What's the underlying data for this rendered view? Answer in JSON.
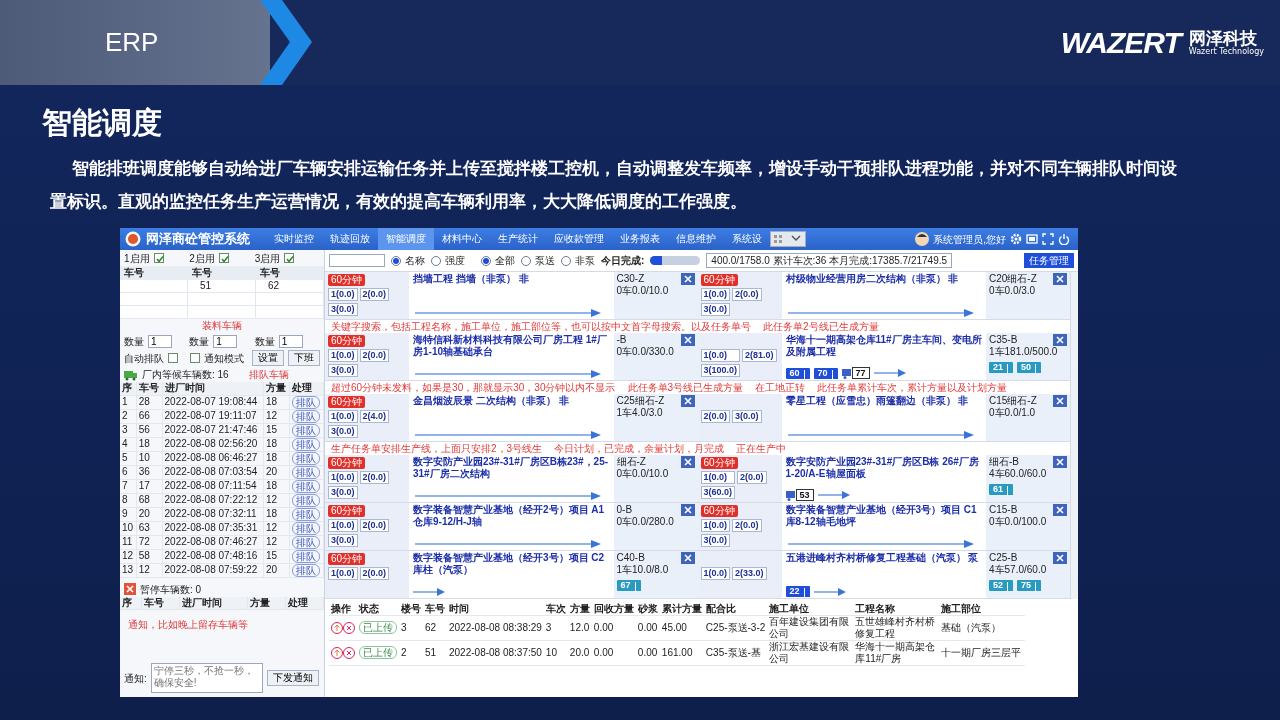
{
  "header": {
    "title": "ERP",
    "logo": "WAZERT",
    "logo_cn": "网泽科技",
    "logo_en": "Wazert Technology"
  },
  "slide_title": "智能调度",
  "intro": "智能排班调度能够自动给进厂车辆安排运输任务并上传至搅拌楼工控机，自动调整发车频率，增设手动干预排队进程功能，并对不同车辆排队时间设置标识。直观的监控任务生产运营情况，有效的提高车辆利用率，大大降低调度的工作强度。",
  "app": {
    "title": "网泽商砼管控系统",
    "nav": [
      {
        "label": "实时监控",
        "selected": false
      },
      {
        "label": "轨迹回放",
        "selected": false
      },
      {
        "label": "智能调度",
        "selected": true
      },
      {
        "label": "材料中心",
        "selected": false
      },
      {
        "label": "生产统计",
        "selected": false
      },
      {
        "label": "应收款管理",
        "selected": false
      },
      {
        "label": "业务报表",
        "selected": false
      },
      {
        "label": "信息维护",
        "selected": false
      },
      {
        "label": "系统设",
        "selected": false
      }
    ],
    "user": "系统管理员,您好",
    "lines": [
      {
        "label": "1启用",
        "checked": true
      },
      {
        "label": "2启用",
        "checked": true
      },
      {
        "label": "3启用",
        "checked": true
      }
    ],
    "loading": [
      {
        "header": "车号",
        "qty_label": "数量",
        "qty": "1"
      },
      {
        "header": "车号",
        "vehicles": [
          "51"
        ],
        "qty_label": "数量",
        "qty": "1"
      },
      {
        "header": "车号",
        "vehicles": [
          "62"
        ],
        "qty_label": "数量",
        "qty": "1"
      }
    ],
    "auto_queue": {
      "label": "自动排队",
      "checked": false
    },
    "notify_mode": {
      "label": "通知模式",
      "checked": false
    },
    "buttons": [
      "设置",
      "下班"
    ],
    "queue": {
      "title": "厂内等候车辆数: 16",
      "columns": [
        "序",
        "车号",
        "进厂时间",
        "方量",
        "处理"
      ],
      "rows": [
        [
          "1",
          "28",
          "2022-08-07 19:08:44",
          "18",
          "排队"
        ],
        [
          "2",
          "66",
          "2022-08-07 19:11:07",
          "12",
          "排队"
        ],
        [
          "3",
          "56",
          "2022-08-07 21:47:46",
          "15",
          "排队"
        ],
        [
          "4",
          "18",
          "2022-08-08 02:56:20",
          "18",
          "排队"
        ],
        [
          "5",
          "10",
          "2022-08-08 06:46:27",
          "18",
          "排队"
        ],
        [
          "6",
          "36",
          "2022-08-08 07:03:54",
          "20",
          "排队"
        ],
        [
          "7",
          "17",
          "2022-08-08 07:11:54",
          "18",
          "排队"
        ],
        [
          "8",
          "68",
          "2022-08-08 07:22:12",
          "12",
          "排队"
        ],
        [
          "9",
          "20",
          "2022-08-08 07:32:11",
          "18",
          "排队"
        ],
        [
          "10",
          "63",
          "2022-08-08 07:35:31",
          "12",
          "排队"
        ],
        [
          "11",
          "72",
          "2022-08-08 07:46:27",
          "12",
          "排队"
        ],
        [
          "12",
          "58",
          "2022-08-08 07:48:16",
          "15",
          "排队"
        ],
        [
          "13",
          "12",
          "2022-08-08 07:59:22",
          "20",
          "排队"
        ]
      ]
    },
    "paused": {
      "title": "暂停车辆数: 0",
      "columns": [
        "序",
        "车号",
        "进厂时间",
        "方量",
        "处理"
      ]
    },
    "notice": {
      "label": "通知:",
      "placeholder": "宁停三秒，不抢一秒，确保安全!",
      "button": "下发通知"
    },
    "toolbar": {
      "filter_a": [
        {
          "label": "名称",
          "selected": true
        },
        {
          "label": "强度",
          "selected": false
        }
      ],
      "filter_b": [
        {
          "label": "全部",
          "selected": true
        },
        {
          "label": "泵送",
          "selected": false
        },
        {
          "label": "非泵",
          "selected": false
        }
      ],
      "today_label": "今日完成:",
      "level": 0.23,
      "stats": "400.0/1758.0 累计车次:36 本月完成:17385.7/21749.5",
      "task_button": "任务管理"
    },
    "tasks": [
      {
        "badge": "60分钟",
        "lines": [
          "1(0.0)",
          "2(0.0)",
          "3(0.0)"
        ],
        "title": "挡墙工程 挡墙（非泵） 非",
        "spec": "C30-Z",
        "progress": "0车0.0/10.0"
      },
      {
        "badge": "60分钟",
        "lines": [
          "1(0.0)",
          "2(0.0)",
          "3(0.0)"
        ],
        "title": "村级物业经营用房二次结构（非泵） 非",
        "spec": "C20细石-Z",
        "progress": "0车0.0/3.0"
      },
      {
        "badge": "60分钟",
        "lines": [
          "1(0.0)",
          "2(0.0)",
          "3(0.0)"
        ],
        "title": "海特信科新材料科技有限公司厂房工程 1#厂房1-10轴基础承台",
        "spec": "-B",
        "progress": "0车0.0/330.0"
      },
      {
        "lines": [
          "1(0.0)",
          "2(81.0)",
          "3(100.0)"
        ],
        "title": "华海十一期高架仓库11#厂房主车间、变电所及附属工程",
        "spec": "C35-B",
        "progress": "1车181.0/500.0",
        "trucks": [
          {
            "number": "60",
            "kind": "road",
            "color": "#1f4fd8"
          },
          {
            "number": "70",
            "kind": "road",
            "color": "#1f4fd8"
          },
          {
            "number": "77",
            "kind": "tag",
            "color": "#3a5fc8"
          },
          {
            "number": "21",
            "kind": "site",
            "color": "#2a9bc0"
          },
          {
            "number": "50",
            "kind": "site",
            "color": "#2a9bc0"
          }
        ]
      },
      {
        "badge": "60分钟",
        "lines": [
          "1(0.0)",
          "2(4.0)",
          "3(0.0)"
        ],
        "title": "金昌烟波辰景 二次结构（非泵） 非",
        "spec": "C25细石-Z",
        "progress": "1车4.0/3.0"
      },
      {
        "lines": [
          "2(0.0)",
          "3(0.0)"
        ],
        "title": "零星工程（应雪忠）雨篷翻边（非泵） 非",
        "spec": "C15细石-Z",
        "progress": "0车0.0/1.0"
      },
      {
        "badge": "60分钟",
        "lines": [
          "1(0.0)",
          "2(0.0)",
          "3(0.0)"
        ],
        "title": "数字安防产业园23#-31#厂房区B栋23#，25-31#厂房二次结构",
        "spec": "细石-Z",
        "progress": "0车0.0/10.0"
      },
      {
        "badge": "60分钟",
        "lines": [
          "1(0.0)",
          "2(0.0)",
          "3(60.0)"
        ],
        "title": "数字安防产业园23#-31#厂房区B栋 26#厂房1-20/A-E轴屋面板",
        "spec": "细石-B",
        "progress": "4车60.0/60.0",
        "trucks": [
          {
            "number": "53",
            "kind": "tag",
            "color": "#3a5fc8"
          },
          {
            "number": "61",
            "kind": "site",
            "color": "#2a9bc0"
          }
        ]
      },
      {
        "badge": "60分钟",
        "lines": [
          "1(0.0)",
          "2(0.0)",
          "3(0.0)"
        ],
        "title": "数字装备智慧产业基地（经开2号）项目 A1仓库9-12/H-J轴",
        "spec": "0-B",
        "progress": "0车0.0/280.0"
      },
      {
        "badge": "60分钟",
        "lines": [
          "1(0.0)",
          "2(0.0)",
          "3(0.0)"
        ],
        "title": "数字装备智慧产业基地（经开3号）项目 C1库8-12轴毛地坪",
        "spec": "C15-B",
        "progress": "0车0.0/100.0"
      },
      {
        "badge": "60分钟",
        "lines": [
          "1(0.0)",
          "2(0.0)"
        ],
        "title": "数字装备智慧产业基地（经开3号）项目 C2库柱（汽泵）",
        "spec": "C40-B",
        "progress": "1车10.0/8.0",
        "trucks": [
          {
            "number": "67",
            "kind": "site",
            "color": "#2a9bc0"
          }
        ]
      },
      {
        "lines": [
          "1(0.0)",
          "2(33.0)"
        ],
        "title": "五港进峰村齐村桥修复工程基础（汽泵） 泵",
        "spec": "C25-B",
        "progress": "4车57.0/60.0",
        "trucks": [
          {
            "number": "22",
            "kind": "road",
            "color": "#1f4fd8"
          },
          {
            "number": "52",
            "kind": "site",
            "color": "#2a9bc0"
          },
          {
            "number": "75",
            "kind": "site",
            "color": "#2a9bc0"
          }
        ]
      }
    ],
    "production": {
      "columns": [
        "操作",
        "状态",
        "楼号",
        "车号",
        "时间",
        "车次",
        "方量",
        "回收方量",
        "砂浆",
        "累计方量",
        "配合比",
        "施工单位",
        "工程名称",
        "施工部位"
      ],
      "rows": [
        {
          "cells": [
            "",
            "已上传",
            "3",
            "62",
            "2022-08-08 08:38:29",
            "3",
            "12.0",
            "0.00",
            "0.00",
            "45.00",
            "C25-泵送-3-2",
            "百年建设集团有限公司",
            "五世雄峰村齐村桥修复工程",
            "基础（汽泵）"
          ]
        },
        {
          "cells": [
            "",
            "已上传",
            "2",
            "51",
            "2022-08-08 08:37:50",
            "10",
            "20.0",
            "0.00",
            "0.00",
            "161.00",
            "C35-泵送-基",
            "浙江宏基建设有限公司",
            "华海十一期高架仓库11#厂房",
            "十一期厂房三层平"
          ]
        }
      ]
    },
    "annotations": [
      "装料车辆",
      "关键字搜索，包括工程名称，施工单位，施工部位等，也可以按中文首字母搜索。以及任务单号",
      "此任务单2号线已生成方量",
      "排队车辆",
      "超过60分钟未发料，如果是30，那就显示30，30分钟以内不显示",
      "此任务单3号线已生成方量",
      "在工地正转",
      "此任务单累计车次，累计方量以及计划方量",
      "生产任务单安排生产线，上面只安排2，3号线生",
      "今日计划，已完成，余量计划，月完成",
      "正在生产中",
      "通知，比如晚上留存车辆等"
    ]
  }
}
